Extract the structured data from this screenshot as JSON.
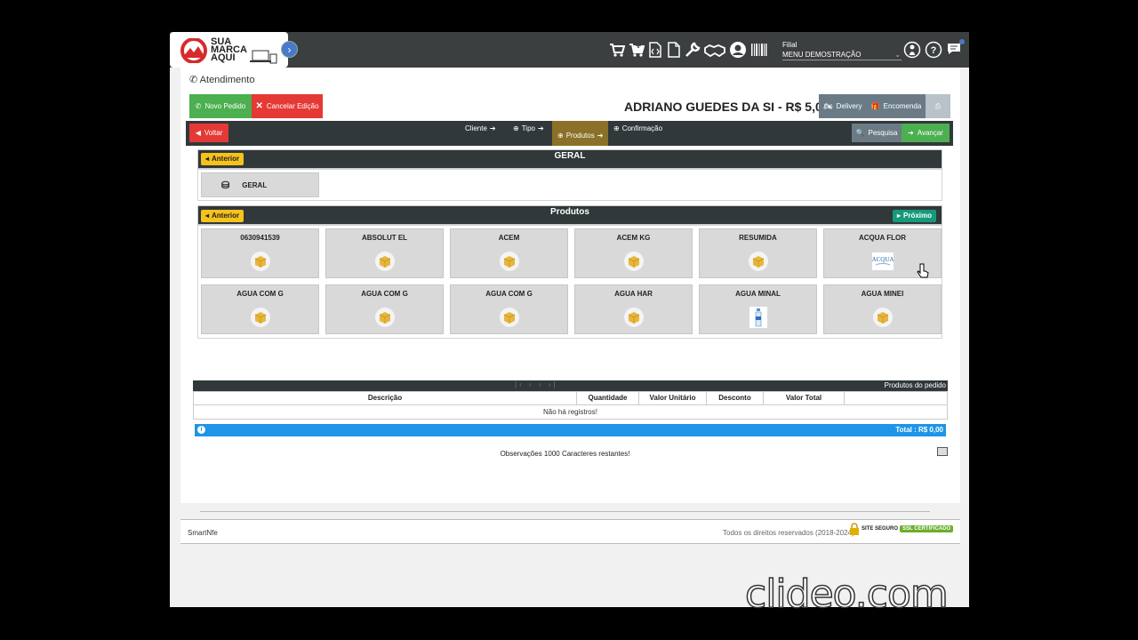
{
  "topbar": {
    "logo_text": "SUA\nMARCA\nAQUI",
    "icons": [
      "cart-icon",
      "add-cart-icon",
      "code-file-icon",
      "file-icon",
      "wrench-icon",
      "handshake-icon",
      "user-circle-icon",
      "barcode-icon"
    ],
    "filial_label": "Filial",
    "filial_value": "MENU DEMOSTRAÇÃO",
    "right_icons": [
      "user-info-icon",
      "help-icon",
      "messages-icon"
    ]
  },
  "breadcrumb": "Atendimento",
  "actions": {
    "new_order": "Novo Pedido",
    "cancel_edit": "Cancelar Edição",
    "delivery": "Delivery",
    "order": "Encomenda"
  },
  "customer_title": "ADRIANO GUEDES DA SI - R$ 5,00",
  "steps": {
    "back": "Voltar",
    "items": [
      "Cliente",
      "Tipo",
      "Produtos",
      "Confirmação"
    ],
    "active": "Produtos",
    "search": "Pesquisa",
    "next": "Avançar"
  },
  "categories_panel": {
    "title": "GERAL",
    "prev": "Anterior",
    "items": [
      {
        "label": "GERAL"
      }
    ]
  },
  "products_panel": {
    "title": "Produtos",
    "prev": "Anterior",
    "next": "Próximo",
    "items": [
      {
        "name": "0630941539",
        "icon": "box-icon"
      },
      {
        "name": "ABSOLUT EL",
        "icon": "box-icon"
      },
      {
        "name": "ACEM",
        "icon": "box-icon"
      },
      {
        "name": "ACEM KG",
        "icon": "box-icon"
      },
      {
        "name": "RESUMIDA",
        "icon": "box-icon"
      },
      {
        "name": "ACQUA FLOR",
        "icon": "acqua-flor-logo"
      },
      {
        "name": "AGUA COM G",
        "icon": "box-icon"
      },
      {
        "name": "AGUA COM G",
        "icon": "box-icon"
      },
      {
        "name": "AGUA COM G",
        "icon": "box-icon"
      },
      {
        "name": "AGUA HAR",
        "icon": "box-icon"
      },
      {
        "name": "AGUA MINAL",
        "icon": "water-bottle-icon"
      },
      {
        "name": "AGUA MINEI",
        "icon": "box-icon"
      }
    ]
  },
  "order_table": {
    "title": "Produtos do pedido",
    "pager": "|‹ ‹  › ›|",
    "columns": [
      "Descrição",
      "Quantidade",
      "Valor Unitário",
      "Desconto",
      "Valor Total",
      ""
    ],
    "empty": "Não há registros!",
    "total": "Total : R$ 0,00"
  },
  "observations_label": "Observações 1000 Caracteres restantes!",
  "footer": {
    "brand": "SmartNfe",
    "rights": "Todos os direitos reservados (2018-2024)",
    "seal_text": "SITE SEGURO",
    "ssl_text": "SSL CERTIFICADO"
  },
  "watermark": "clideo.com",
  "colors": {
    "green": "#4caf50",
    "red": "#e53935",
    "yellow": "#f6c21c",
    "teal": "#159a7c",
    "dark": "#30383a",
    "blue": "#1e95e8",
    "grey_btn": "#6b7b86"
  }
}
